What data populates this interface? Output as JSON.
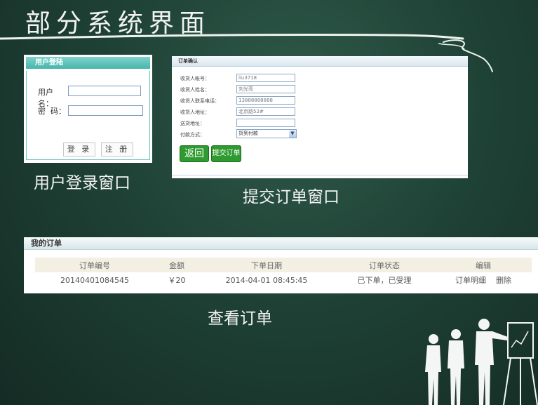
{
  "slide": {
    "title": "部分系统界面"
  },
  "login": {
    "header": "用户登陆",
    "username_label": "用户名：",
    "password_label": "密  码：",
    "username_value": "",
    "password_value": "",
    "login_button": "登 录",
    "register_button": "注 册",
    "caption": "用户登录窗口"
  },
  "order_confirm": {
    "header": "订单确认",
    "fields": [
      {
        "label": "收货人帐号：",
        "value": "liu3718"
      },
      {
        "label": "收货人姓名：",
        "value": "刘光亮"
      },
      {
        "label": "收货人联系电话：",
        "value": "13888888888"
      },
      {
        "label": "收货人地址：",
        "value": "北京路52#"
      },
      {
        "label": "送货地址：",
        "value": ""
      }
    ],
    "payment_label": "付款方式：",
    "payment_value": "货到付款",
    "back_button": "返回",
    "submit_button": "提交订单",
    "caption": "提交订单窗口"
  },
  "my_orders": {
    "header": "我的订单",
    "columns": [
      "订单编号",
      "金额",
      "下单日期",
      "订单状态",
      "编辑"
    ],
    "rows": [
      {
        "order_no": "20140401084545",
        "amount": "￥20",
        "date": "2014-04-01 08:45:45",
        "status": "已下单，已受理",
        "detail_link": "订单明细",
        "delete_link": "删除"
      }
    ],
    "caption": "查看订单"
  }
}
